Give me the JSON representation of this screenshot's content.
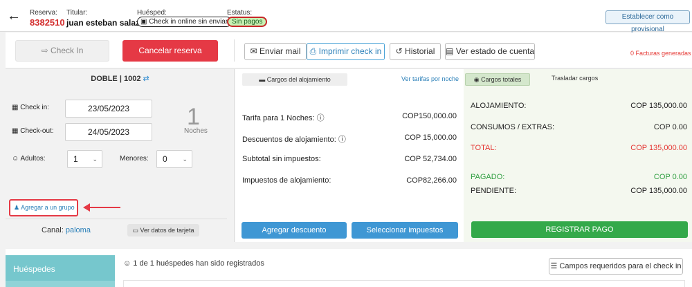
{
  "header": {
    "reserva_label": "Reserva:",
    "reserva_num": "8382510",
    "titular_label": "Titular:",
    "titular_name": "juan esteban salazar",
    "huesped_label": "Huésped:",
    "huesped_badge": "Check in online sin enviar",
    "estatus_label": "Estatus:",
    "estatus_badge": "Sin pagos",
    "provisional_button": "Establecer como provisional"
  },
  "actions": {
    "checkin": "Check In",
    "cancel": "Cancelar reserva",
    "mail": "Enviar mail",
    "print": "Imprimir check in",
    "history": "Historial",
    "account": "Ver estado de cuenta",
    "facturas": "0 Facturas generadas"
  },
  "room": {
    "type": "DOBLE",
    "number": "1002",
    "checkin_label": "Check in:",
    "checkin_value": "23/05/2023",
    "checkout_label": "Check-out:",
    "checkout_value": "24/05/2023",
    "nights": "1",
    "nights_label": "Noches",
    "adults_label": "Adultos:",
    "adults_value": "1",
    "minors_label": "Menores:",
    "minors_value": "0",
    "group_link": "Agregar a un grupo",
    "canal_label": "Canal:",
    "canal_value": "paloma",
    "card_button": "Ver datos de tarjeta"
  },
  "charges": {
    "tab": "Cargos del alojamiento",
    "tarifas_link": "Ver tarifas por noche",
    "rows": [
      {
        "label": "Tarifa para 1 Noches:",
        "value": "COP150,000.00"
      },
      {
        "label": "Descuentos de alojamiento:",
        "value": "COP 15,000.00"
      },
      {
        "label": "Subtotal sin impuestos:",
        "value": "COP 52,734.00"
      },
      {
        "label": "Impuestos de alojamiento:",
        "value": "COP82,266.00"
      }
    ],
    "discount_button": "Agregar descuento",
    "taxes_button": "Seleccionar impuestos"
  },
  "totals": {
    "tab": "Cargos totales",
    "transfer_tab": "Trasladar cargos",
    "alojamiento_label": "ALOJAMIENTO:",
    "alojamiento_value": "COP 135,000.00",
    "consumos_label": "CONSUMOS / EXTRAS:",
    "consumos_value": "COP 0.00",
    "total_label": "TOTAL:",
    "total_value": "COP 135,000.00",
    "pagado_label": "PAGADO:",
    "pagado_value": "COP 0.00",
    "pendiente_label": "PENDIENTE:",
    "pendiente_value": "COP 135,000.00",
    "pay_button": "REGISTRAR PAGO"
  },
  "guests": {
    "tab": "Huéspedes",
    "info": "1 de 1 huéspedes han sido registrados",
    "fields_button": "Campos requeridos para el check in"
  },
  "colors": {
    "cancel_red": "#e53945",
    "primary_blue": "#3f97d4",
    "pay_green": "#34a94a",
    "teal_tab": "#76c7cd"
  }
}
